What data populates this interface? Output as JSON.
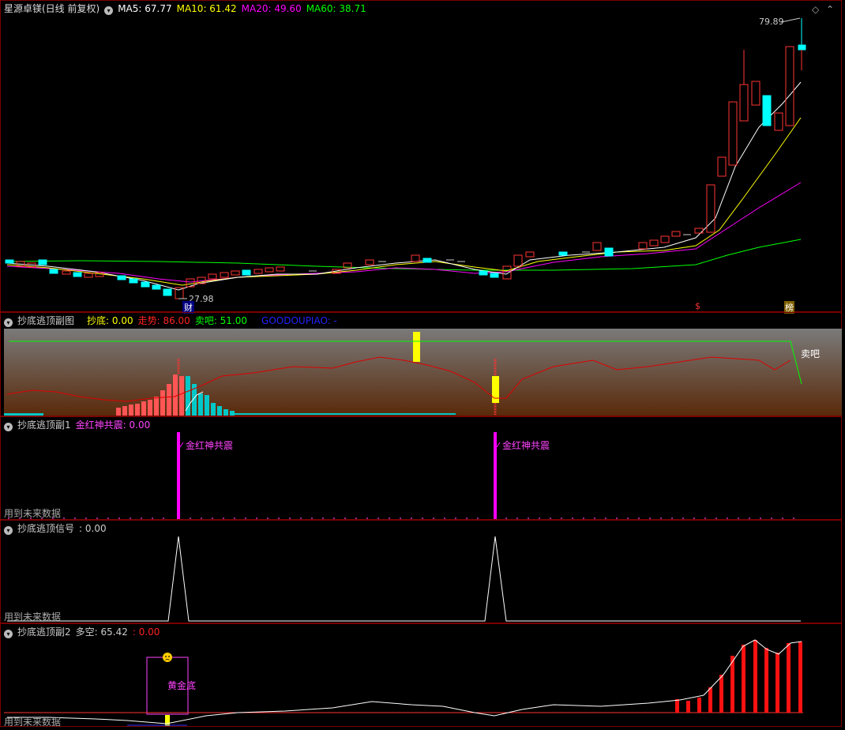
{
  "main": {
    "title": "星源卓镁(日线 前复权)",
    "ma5": "MA5: 67.77",
    "ma10": "MA10: 61.42",
    "ma20": "MA20: 49.60",
    "ma60": "MA60: 38.71",
    "high_label": "79.89",
    "low_label": "27.98",
    "marker_cai": "财",
    "marker_dollar": "$",
    "marker_bang": "榜",
    "colors": {
      "ma5": "#ffffff",
      "ma10": "#ffff00",
      "ma20": "#ff00ff",
      "ma60": "#00ff00",
      "up": "#ff3333",
      "down": "#00ffff"
    }
  },
  "sub1": {
    "title": "抄底逃顶副图",
    "chaodi": "抄底: 0.00",
    "zoushi": "走势: 86.00",
    "maiba": "卖吧: 51.00",
    "goodou": "GOODOUPIAO: -",
    "maiba_label": "卖吧"
  },
  "sub2": {
    "title": "抄底逃顶副1",
    "value": "金红神共震: 0.00",
    "label1": "金红神共震",
    "label2": "金红神共震",
    "watermark": "用到未来数据"
  },
  "sub3": {
    "title": "抄底逃顶信号",
    "value": ": 0.00",
    "watermark": "用到未来数据"
  },
  "sub4": {
    "title": "抄底逃顶副2",
    "duokong": "多空: 65.42",
    "value": ": 0.00",
    "box_label": "黄金底",
    "watermark": "用到未来数据"
  }
}
